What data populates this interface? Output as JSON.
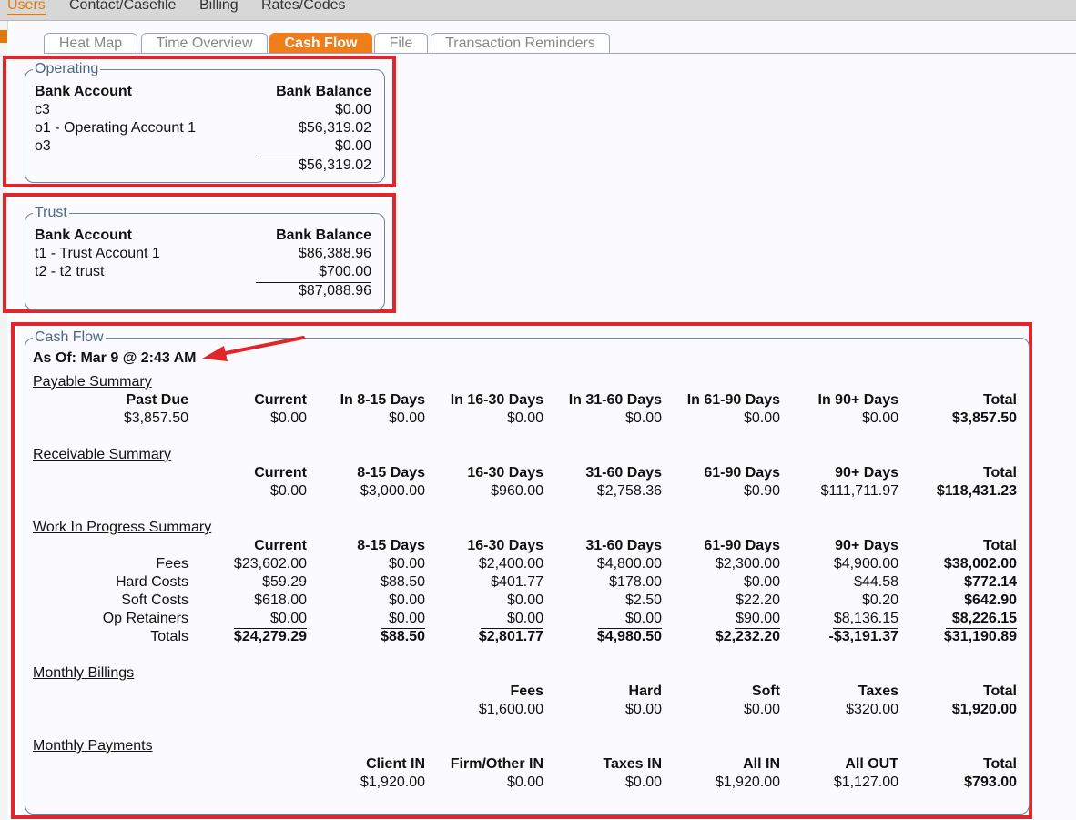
{
  "topnav": [
    "Users",
    "Contact/Casefile",
    "Billing",
    "Rates/Codes"
  ],
  "tabs": [
    "Heat Map",
    "Time Overview",
    "Cash Flow",
    "File",
    "Transaction Reminders"
  ],
  "operating": {
    "legend": "Operating",
    "col_account": "Bank Account",
    "col_balance": "Bank Balance",
    "rows": [
      {
        "account": "c3",
        "balance": "$0.00"
      },
      {
        "account": "o1 - Operating Account 1",
        "balance": "$56,319.02"
      },
      {
        "account": "o3",
        "balance": "$0.00"
      }
    ],
    "total": "$56,319.02"
  },
  "trust": {
    "legend": "Trust",
    "col_account": "Bank Account",
    "col_balance": "Bank Balance",
    "rows": [
      {
        "account": "t1 - Trust Account 1",
        "balance": "$86,388.96"
      },
      {
        "account": "t2 - t2 trust",
        "balance": "$700.00"
      }
    ],
    "total": "$87,088.96"
  },
  "cashflow": {
    "legend": "Cash Flow",
    "as_of": "As Of: Mar 9 @ 2:43 AM",
    "payable": {
      "title": "Payable Summary",
      "headers": [
        "Past Due",
        "Current",
        "In 8-15 Days",
        "In 16-30 Days",
        "In 31-60 Days",
        "In 61-90 Days",
        "In 90+ Days",
        "Total"
      ],
      "values": [
        "$3,857.50",
        "$0.00",
        "$0.00",
        "$0.00",
        "$0.00",
        "$0.00",
        "$0.00",
        "$3,857.50"
      ]
    },
    "receivable": {
      "title": "Receivable Summary",
      "headers": [
        "Current",
        "8-15 Days",
        "16-30 Days",
        "31-60 Days",
        "61-90 Days",
        "90+ Days",
        "Total"
      ],
      "values": [
        "$0.00",
        "$3,000.00",
        "$960.00",
        "$2,758.36",
        "$0.90",
        "$111,711.97",
        "$118,431.23"
      ]
    },
    "wip": {
      "title": "Work In Progress Summary",
      "headers": [
        "Current",
        "8-15 Days",
        "16-30 Days",
        "31-60 Days",
        "61-90 Days",
        "90+ Days",
        "Total"
      ],
      "rows": [
        {
          "label": "Fees",
          "values": [
            "$23,602.00",
            "$0.00",
            "$2,400.00",
            "$4,800.00",
            "$2,300.00",
            "$4,900.00",
            "$38,002.00"
          ]
        },
        {
          "label": "Hard Costs",
          "values": [
            "$59.29",
            "$88.50",
            "$401.77",
            "$178.00",
            "$0.00",
            "$44.58",
            "$772.14"
          ]
        },
        {
          "label": "Soft Costs",
          "values": [
            "$618.00",
            "$0.00",
            "$0.00",
            "$2.50",
            "$22.20",
            "$0.20",
            "$642.90"
          ]
        },
        {
          "label": "Op Retainers",
          "values": [
            "$0.00",
            "$0.00",
            "$0.00",
            "$0.00",
            "$90.00",
            "$8,136.15",
            "$8,226.15"
          ]
        }
      ],
      "totals_label": "Totals",
      "totals": [
        "$24,279.29",
        "$88.50",
        "$2,801.77",
        "$4,980.50",
        "$2,232.20",
        "-$3,191.37",
        "$31,190.89"
      ]
    },
    "billings": {
      "title": "Monthly Billings",
      "headers": [
        "Fees",
        "Hard",
        "Soft",
        "Taxes",
        "Total"
      ],
      "values": [
        "$1,600.00",
        "$0.00",
        "$0.00",
        "$320.00",
        "$1,920.00"
      ]
    },
    "payments": {
      "title": "Monthly Payments",
      "headers": [
        "Client IN",
        "Firm/Other IN",
        "Taxes IN",
        "All IN",
        "All OUT",
        "Total"
      ],
      "values": [
        "$1,920.00",
        "$0.00",
        "$0.00",
        "$1,920.00",
        "$1,127.00",
        "$793.00"
      ]
    }
  },
  "colors": {
    "accent": "#ee7d1a",
    "highlight": "#e0262a",
    "legend": "#4a6784"
  }
}
